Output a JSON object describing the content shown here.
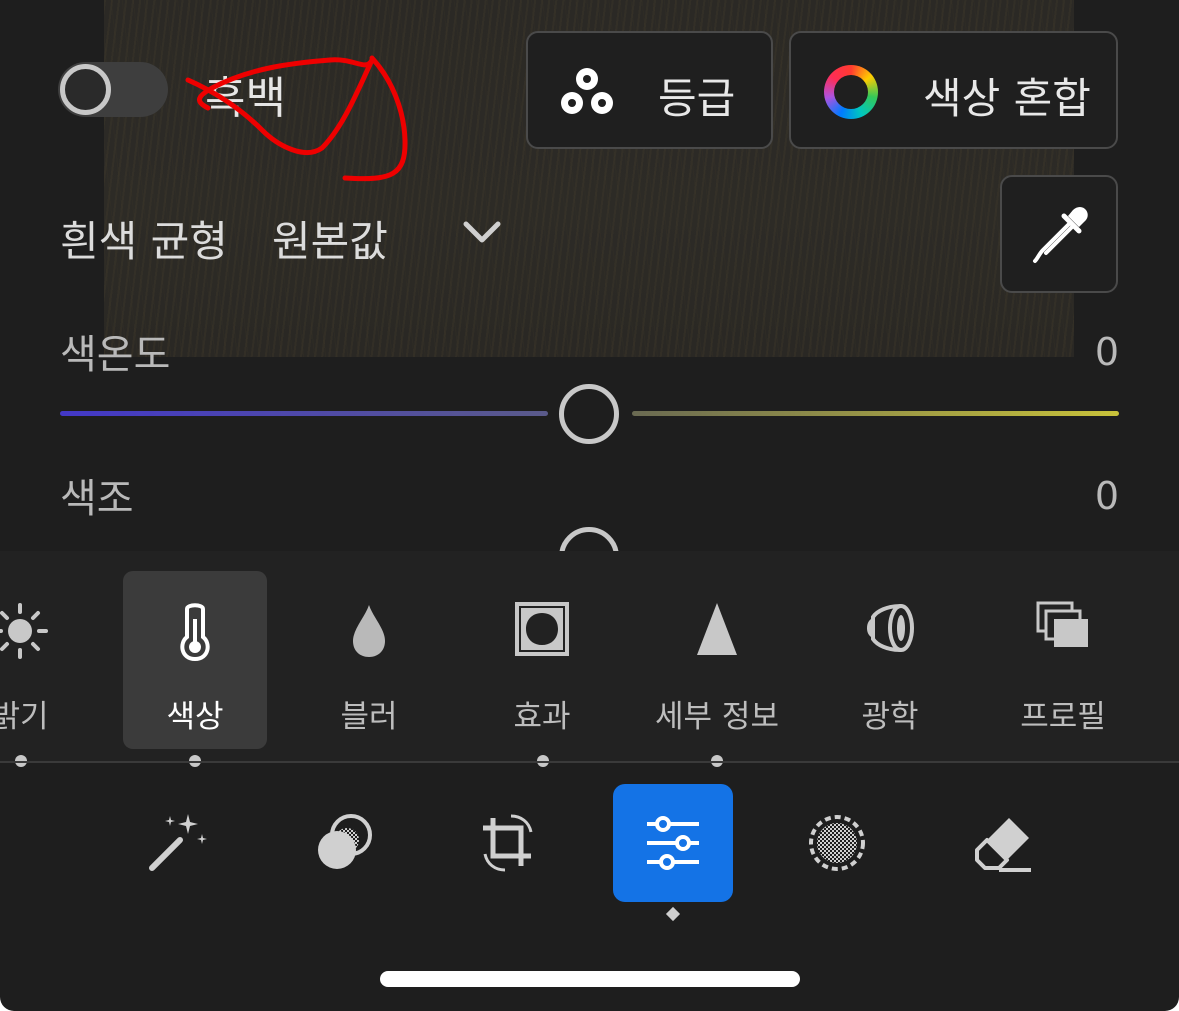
{
  "color_panel": {
    "bw_toggle": {
      "label": "흑백",
      "state": "off"
    },
    "grade_button": {
      "label": "등급",
      "icon": "color-grading-icon"
    },
    "mix_button": {
      "label": "색상 혼합",
      "icon": "color-wheel-icon"
    },
    "white_balance": {
      "label": "흰색 균형",
      "value": "원본값",
      "icon": "chevron-down-icon"
    },
    "eyedropper": {
      "icon": "eyedropper-icon"
    },
    "sliders": [
      {
        "label": "색온도",
        "value": "0",
        "level": 0.5
      },
      {
        "label": "색조",
        "value": "0",
        "level": 0.5
      }
    ],
    "annotation_color": "#ff0000"
  },
  "tool_panel": {
    "tools": [
      {
        "label": "밝기",
        "icon": "sun-icon"
      },
      {
        "label": "색상",
        "icon": "thermometer-icon",
        "active": true
      },
      {
        "label": "블러",
        "icon": "droplet-icon"
      },
      {
        "label": "효과",
        "icon": "vignette-icon"
      },
      {
        "label": "세부 정보",
        "icon": "triangle-icon"
      },
      {
        "label": "광학",
        "icon": "lens-icon"
      },
      {
        "label": "프로필",
        "icon": "profile-stack-icon"
      }
    ]
  },
  "bottom_bar": {
    "modes": [
      {
        "name": "auto",
        "icon": "magic-wand-icon"
      },
      {
        "name": "masking",
        "icon": "mask-circles-icon"
      },
      {
        "name": "crop",
        "icon": "crop-rotate-icon"
      },
      {
        "name": "edit",
        "icon": "sliders-icon",
        "active": true
      },
      {
        "name": "selective",
        "icon": "dotted-circle-icon"
      },
      {
        "name": "healing",
        "icon": "eraser-icon"
      }
    ]
  },
  "colors": {
    "accent": "#1473e6",
    "background": "#1e1e1e",
    "temp_left": "#4338c8",
    "temp_right": "#c8c23a"
  }
}
